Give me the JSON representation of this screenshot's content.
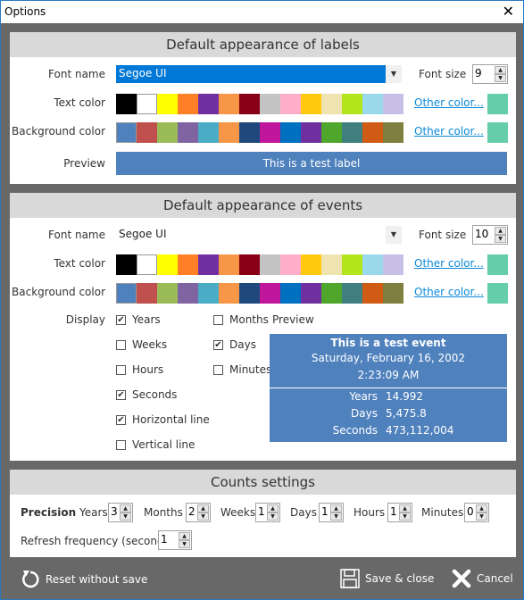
{
  "window": {
    "title": "Options",
    "close_glyph": "✕"
  },
  "labels_section": {
    "header": "Default appearance of labels",
    "font_name_label": "Font name",
    "font_name_value": "Segoe UI",
    "font_size_label": "Font size",
    "font_size_value": "9",
    "text_color_label": "Text color",
    "text_colors": [
      "#000000",
      "#ffffff",
      "#ffff00",
      "#ff7f27",
      "#7030a0",
      "#f79646",
      "#880015",
      "#c3c3c3",
      "#ffaec9",
      "#ffc90e",
      "#efe4b0",
      "#b5e61d",
      "#99d9ea",
      "#c8bfe7"
    ],
    "text_other_color": "Other color...",
    "text_current_color": "#66cdaa",
    "bg_color_label": "Background color",
    "bg_colors": [
      "#4f81bd",
      "#c0504d",
      "#9bbb59",
      "#8064a2",
      "#4bacc6",
      "#f79646",
      "#1f497d",
      "#c0169c",
      "#0070c0",
      "#7030a0",
      "#4ea72a",
      "#3f7f7f",
      "#d05b14",
      "#7f7f3f"
    ],
    "bg_other_color": "Other color...",
    "bg_current_color": "#66cdaa",
    "preview_label": "Preview",
    "preview_text": "This is a test label"
  },
  "events_section": {
    "header": "Default appearance of events",
    "font_name_label": "Font name",
    "font_name_value": "Segoe UI",
    "font_size_label": "Font size",
    "font_size_value": "10",
    "text_color_label": "Text color",
    "text_colors": [
      "#000000",
      "#ffffff",
      "#ffff00",
      "#ff7f27",
      "#7030a0",
      "#f79646",
      "#880015",
      "#c3c3c3",
      "#ffaec9",
      "#ffc90e",
      "#efe4b0",
      "#b5e61d",
      "#99d9ea",
      "#c8bfe7"
    ],
    "text_other_color": "Other color...",
    "text_current_color": "#66cdaa",
    "bg_color_label": "Background color",
    "bg_colors": [
      "#4f81bd",
      "#c0504d",
      "#9bbb59",
      "#8064a2",
      "#4bacc6",
      "#f79646",
      "#1f497d",
      "#c0169c",
      "#0070c0",
      "#7030a0",
      "#4ea72a",
      "#3f7f7f",
      "#d05b14",
      "#7f7f3f"
    ],
    "bg_other_color": "Other color...",
    "bg_current_color": "#66cdaa",
    "display_label": "Display",
    "display_options": [
      {
        "label": "Years",
        "checked": true
      },
      {
        "label": "Weeks",
        "checked": false
      },
      {
        "label": "Hours",
        "checked": false
      },
      {
        "label": "Seconds",
        "checked": true
      },
      {
        "label": "Horizontal line",
        "checked": true
      },
      {
        "label": "Vertical line",
        "checked": false
      },
      {
        "label": "Months",
        "checked": false
      },
      {
        "label": "Days",
        "checked": true
      },
      {
        "label": "Minutes",
        "checked": false
      }
    ],
    "preview_label": "Preview",
    "preview": {
      "title": "This is a test event",
      "date": "Saturday, February 16, 2002",
      "time": "2:23:09 AM",
      "rows": [
        {
          "key": "Years",
          "value": "14.992"
        },
        {
          "key": "Days",
          "value": "5,475.8"
        },
        {
          "key": "Seconds",
          "value": "473,112,004"
        }
      ]
    }
  },
  "counts_section": {
    "header": "Counts settings",
    "precision_label": "Precision",
    "precision": [
      {
        "label": "Years",
        "value": "3"
      },
      {
        "label": "Months",
        "value": "2"
      },
      {
        "label": "Weeks",
        "value": "1"
      },
      {
        "label": "Days",
        "value": "1"
      },
      {
        "label": "Hours",
        "value": "1"
      },
      {
        "label": "Minutes",
        "value": "0"
      }
    ],
    "refresh_label": "Refresh frequency (seconds)",
    "refresh_value": "1"
  },
  "footer": {
    "reset_label": "Reset without save",
    "save_label": "Save & close",
    "cancel_label": "Cancel"
  },
  "spinner": {
    "up": "▲",
    "down": "▼"
  },
  "dropdown_arrow": "▼",
  "checkmark": "✔"
}
